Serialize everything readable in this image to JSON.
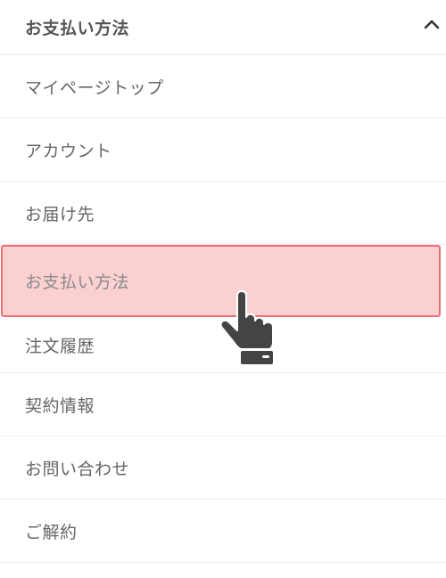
{
  "header": {
    "title": "お支払い方法",
    "chevron_icon": "chevron-up-icon"
  },
  "menu": {
    "items": [
      {
        "label": "マイページトップ",
        "active": false
      },
      {
        "label": "アカウント",
        "active": false
      },
      {
        "label": "お届け先",
        "active": false
      },
      {
        "label": "お支払い方法",
        "active": true
      },
      {
        "label": "注文履歴",
        "active": false
      },
      {
        "label": "契約情報",
        "active": false
      },
      {
        "label": "お問い合わせ",
        "active": false
      },
      {
        "label": "ご解約",
        "active": false
      }
    ]
  },
  "colors": {
    "active_background": "#fbd0d1",
    "active_border": "#ef6f73",
    "text": "#666666",
    "divider": "#ececec"
  },
  "cursor": {
    "icon": "hand-pointer-icon"
  }
}
